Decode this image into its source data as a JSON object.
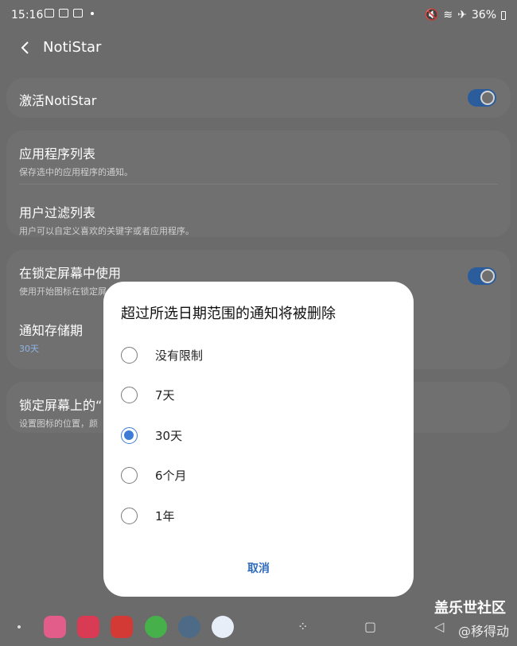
{
  "status_bar": {
    "time": "15:16",
    "battery": "36%"
  },
  "app_bar": {
    "title": "NotiStar"
  },
  "settings": {
    "activate": {
      "label": "激活NotiStar"
    },
    "app_list": {
      "label": "应用程序列表",
      "sub": "保存选中的应用程序的通知。"
    },
    "filter_list": {
      "label": "用户过滤列表",
      "sub": "用户可以自定义喜欢的关键字或者应用程序。"
    },
    "lock_screen": {
      "label": "在锁定屏幕中使用",
      "sub": "使用开始图标在锁定屏"
    },
    "storage": {
      "label": "通知存储期",
      "value": "30天"
    },
    "lock_pos": {
      "label": "锁定屏幕上的“",
      "sub": "设置图标的位置，颜"
    }
  },
  "dialog": {
    "title": "超过所选日期范围的通知将被删除",
    "options": [
      "没有限制",
      "7天",
      "30天",
      "6个月",
      "1年"
    ],
    "selected_index": 2,
    "cancel": "取消"
  },
  "nav": {
    "watermark": "盖乐世社区",
    "watermark_sub": "@移得动",
    "app_icons": [
      "notes-app",
      "store-app",
      "toutiao-app",
      "wechat-app",
      "settings-app",
      "bixby-app"
    ]
  },
  "colors": {
    "accent": "#3e7bd6",
    "scrim": "#6b6b6b",
    "toggle_on": "#2b5d9c"
  }
}
